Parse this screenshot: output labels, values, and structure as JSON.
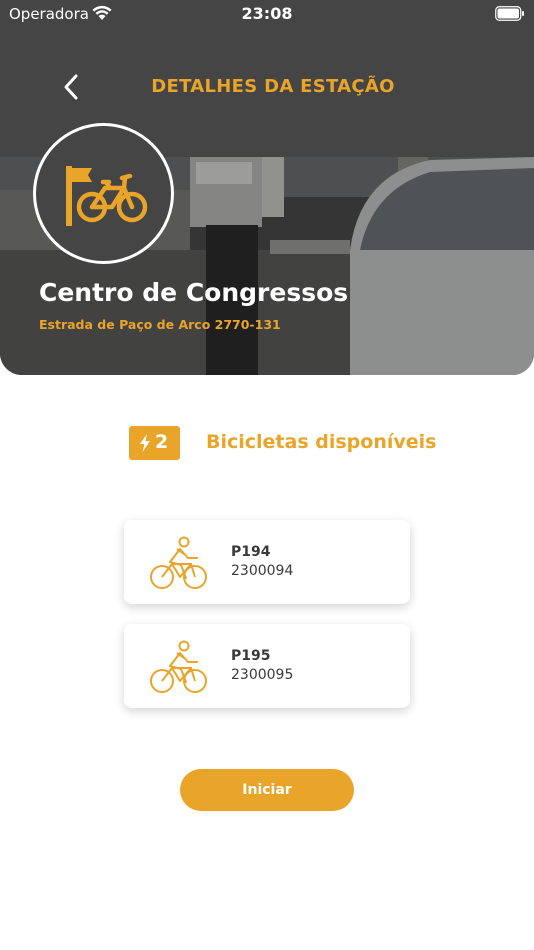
{
  "status_bar": {
    "carrier": "Operadora",
    "time": "23:08"
  },
  "nav": {
    "title": "DETALHES DA ESTAÇÃO"
  },
  "station": {
    "name": "Centro de Congressos",
    "address": "Estrada de Paço de Arco 2770-131"
  },
  "availability": {
    "count": "2",
    "label": "Bicicletas disponíveis"
  },
  "bikes": [
    {
      "code": "P194",
      "serial": "2300094"
    },
    {
      "code": "P195",
      "serial": "2300095"
    }
  ],
  "actions": {
    "start_label": "Iniciar"
  },
  "colors": {
    "accent": "#e9a42a",
    "header_bg": "#454545",
    "text_dark": "#3a3a3a"
  }
}
